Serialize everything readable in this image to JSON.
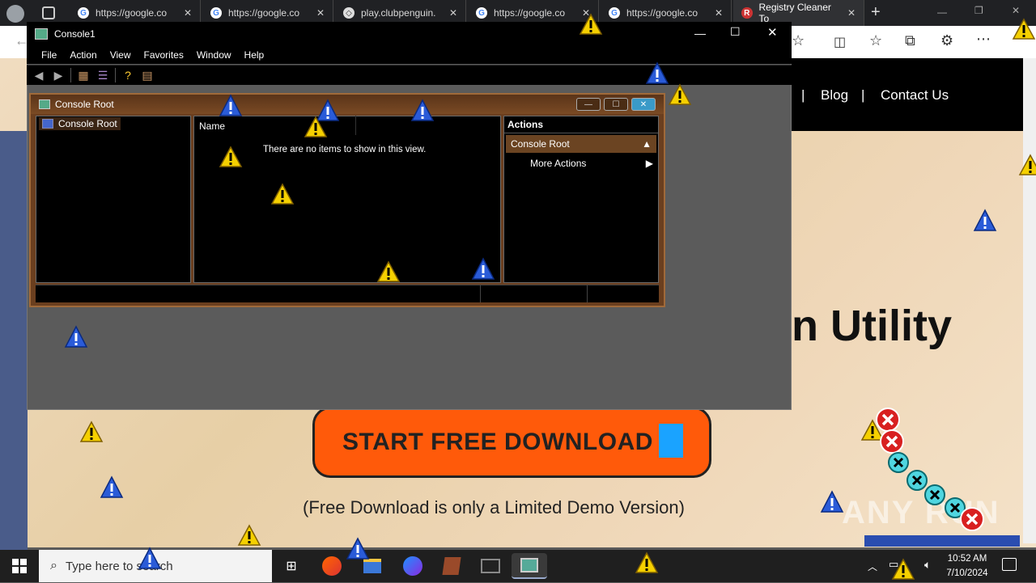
{
  "browser": {
    "tabs": [
      {
        "label": "https://google.co",
        "close": "✕"
      },
      {
        "label": "https://google.co",
        "close": "✕"
      },
      {
        "label": "play.clubpenguin.",
        "close": "✕"
      },
      {
        "label": "https://google.co",
        "close": "✕"
      },
      {
        "label": "https://google.co",
        "close": "✕"
      },
      {
        "label": "Registry Cleaner To",
        "close": "✕"
      }
    ],
    "new_tab": "+"
  },
  "site": {
    "nav": [
      "|",
      "Blog",
      "|",
      "Contact Us"
    ],
    "headline_fragment": "n Utility",
    "download_button": "START FREE DOWNLOAD",
    "demo_note": "(Free Download is only a Limited Demo Version)",
    "watermark": "ANY RUN"
  },
  "console": {
    "title": "Console1",
    "menu": [
      "File",
      "Action",
      "View",
      "Favorites",
      "Window",
      "Help"
    ],
    "inner_title": "Console Root",
    "tree_root": "Console Root",
    "column_name": "Name",
    "empty_message": "There are no items to show in this view.",
    "actions_header": "Actions",
    "actions_root": "Console Root",
    "more_actions": "More Actions",
    "window_controls": {
      "minimize": "—",
      "maximize": "☐",
      "close": "✕"
    }
  },
  "taskbar": {
    "search_placeholder": "Type here to search",
    "time": "10:52 AM",
    "date": "7/10/2024"
  },
  "colors": {
    "download_button": "#ff5a0a",
    "console_frame": "#6b3f1f",
    "taskbar": "#1f1f1f"
  }
}
